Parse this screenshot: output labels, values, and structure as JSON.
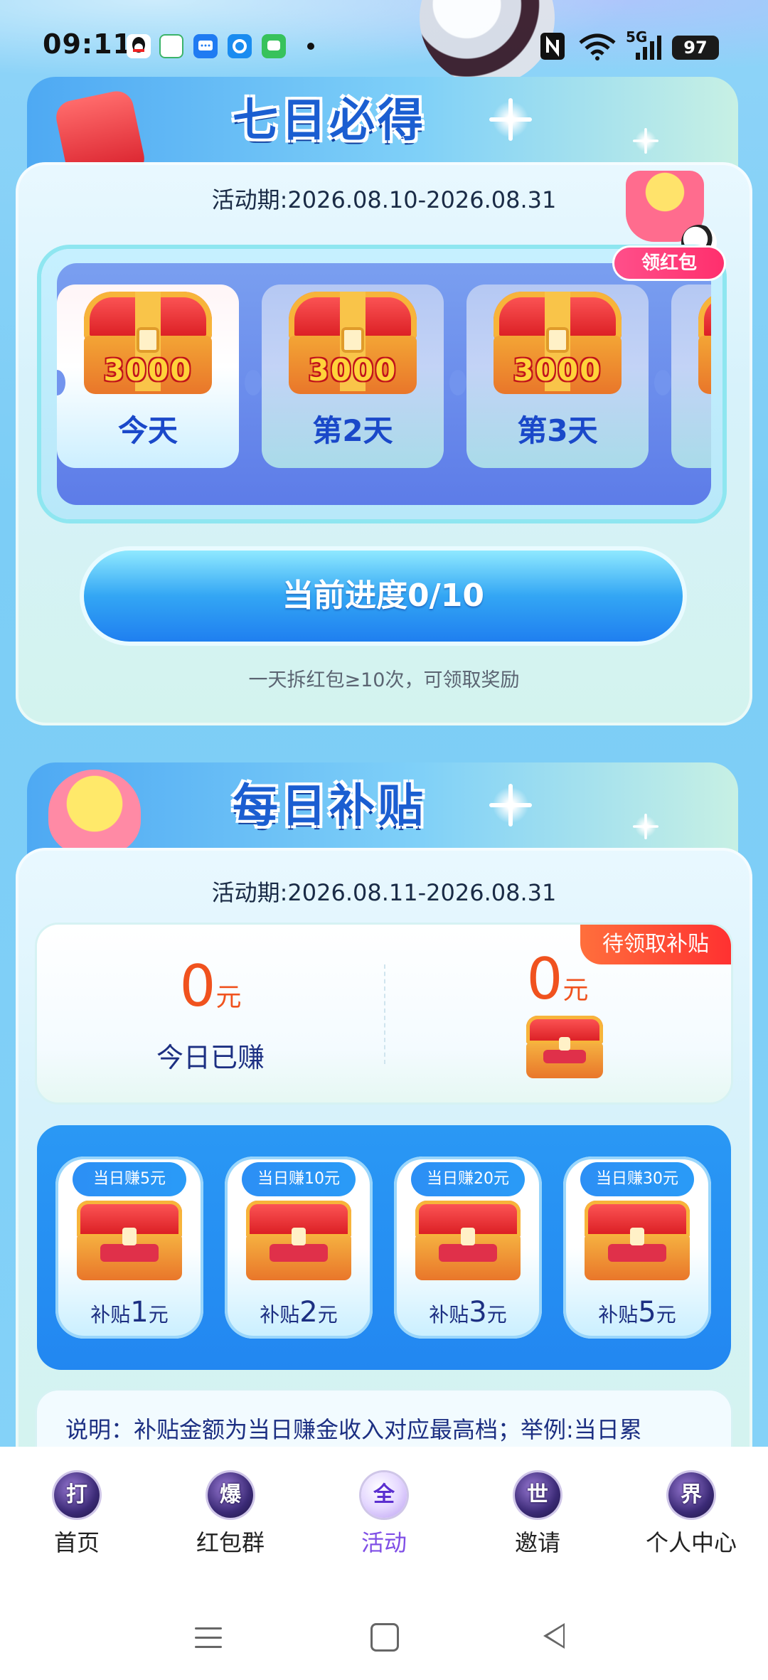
{
  "status_bar": {
    "time": "09:11",
    "network": "5G",
    "battery": "97",
    "icons": [
      "qq-icon",
      "mobile-carrier-icon",
      "message-icon",
      "pinwheel-app-icon",
      "chat-icon",
      "dot-icon",
      "nfc-icon",
      "wifi-icon",
      "signal-icon"
    ]
  },
  "seven_day": {
    "title": "七日必得",
    "period": "活动期:2026.08.10-2026.08.31",
    "badge": "领红包",
    "days": [
      {
        "amount": "3000",
        "label": "今天"
      },
      {
        "amount": "3000",
        "label": "第2天"
      },
      {
        "amount": "3000",
        "label": "第3天"
      }
    ],
    "progress_button": "当前进度0/10",
    "hint": "一天拆红包≥10次，可领取奖励"
  },
  "daily_subsidy": {
    "title": "每日补贴",
    "period": "活动期:2026.08.11-2026.08.31",
    "earned_today": {
      "value": "0",
      "unit": "元",
      "label": "今日已赚"
    },
    "pending": {
      "tag": "待领取补贴",
      "value": "0",
      "unit": "元"
    },
    "tiers": [
      {
        "tag": "当日赚5元",
        "prefix": "补贴",
        "amount": "1",
        "unit": "元"
      },
      {
        "tag": "当日赚10元",
        "prefix": "补贴",
        "amount": "2",
        "unit": "元"
      },
      {
        "tag": "当日赚20元",
        "prefix": "补贴",
        "amount": "3",
        "unit": "元"
      },
      {
        "tag": "当日赚30元",
        "prefix": "补贴",
        "amount": "5",
        "unit": "元"
      }
    ],
    "note": "说明：补贴金额为当日赚金收入对应最高档；举例:当日累"
  },
  "bottom_nav": {
    "items": [
      {
        "glyph": "打",
        "label": "首页",
        "active": false
      },
      {
        "glyph": "爆",
        "label": "红包群",
        "active": false
      },
      {
        "glyph": "全",
        "label": "活动",
        "active": true
      },
      {
        "glyph": "世",
        "label": "邀请",
        "active": false
      },
      {
        "glyph": "界",
        "label": "个人中心",
        "active": false
      }
    ]
  },
  "colors": {
    "accent_orange": "#f0521e",
    "title_blue": "#1b5ed1",
    "nav_active": "#7f4ee6"
  }
}
